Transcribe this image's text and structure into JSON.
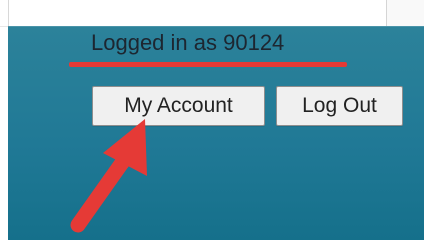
{
  "account_panel": {
    "status_text": "Logged in as 90124",
    "my_account_label": "My Account",
    "log_out_label": "Log Out"
  },
  "annotation": {
    "highlight_color": "#e53a36",
    "arrow_icon": "red-arrow-icon"
  },
  "colors": {
    "panel": "#207996",
    "button": "#f0f0f0"
  }
}
